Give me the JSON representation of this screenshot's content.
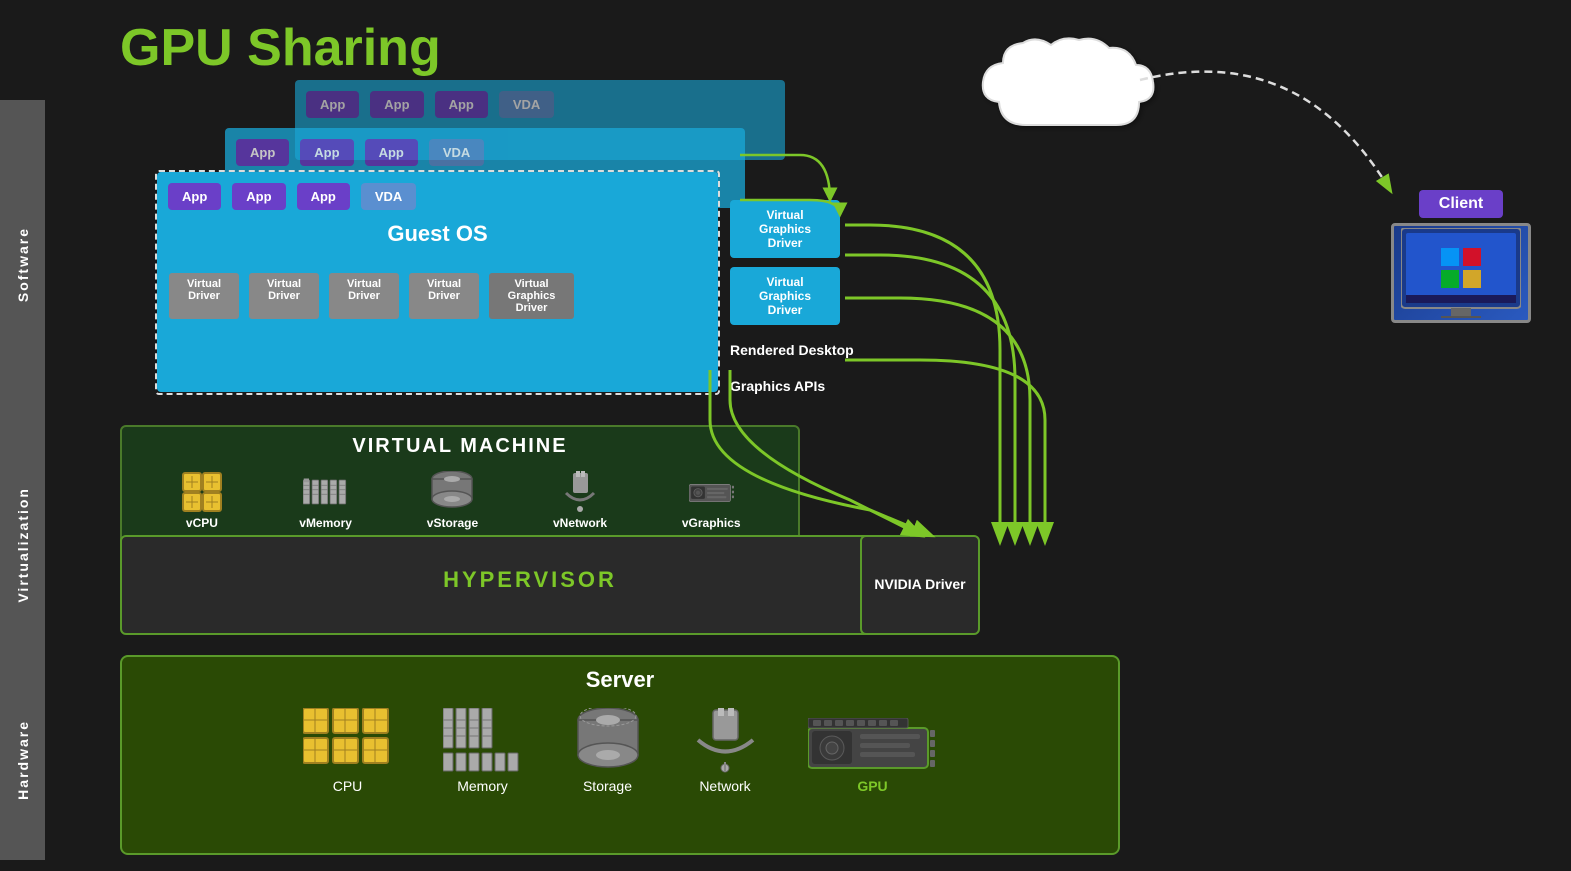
{
  "title": "GPU Sharing",
  "side_labels": {
    "software": "Software",
    "virtualization": "Virtualization",
    "hardware": "Hardware"
  },
  "vm_layers": [
    {
      "id": "vm3",
      "apps": [
        "App",
        "App",
        "App",
        "VDA"
      ],
      "offset": "back"
    },
    {
      "id": "vm2",
      "apps": [
        "App",
        "App",
        "App",
        "VDA"
      ],
      "offset": "middle"
    },
    {
      "id": "vm1",
      "apps": [
        "App",
        "App",
        "App",
        "VDA"
      ],
      "guest_os_label": "Guest OS",
      "drivers": [
        "Virtual\nDriver",
        "Virtual\nDriver",
        "Virtual\nDriver",
        "Virtual\nDriver",
        "Virtual\nGraphics\nDriver"
      ]
    }
  ],
  "right_panel": {
    "vgd_label1": "Virtual\nGraphics\nDriver",
    "vgd_label2": "Virtual\nGraphics\nDriver",
    "rendered_desktop": "Rendered Desktop",
    "graphics_apis": "Graphics APIs"
  },
  "virtual_machine": {
    "title": "VIRTUAL MACHINE",
    "items": [
      {
        "label": "vCPU",
        "icon": "cpu-icon"
      },
      {
        "label": "vMemory",
        "icon": "memory-icon"
      },
      {
        "label": "vStorage",
        "icon": "storage-icon"
      },
      {
        "label": "vNetwork",
        "icon": "network-icon"
      },
      {
        "label": "vGraphics",
        "icon": "graphics-icon"
      }
    ]
  },
  "hypervisor": {
    "label": "HYPERVISOR"
  },
  "nvidia_driver": {
    "label": "NVIDIA\nDriver"
  },
  "server": {
    "title": "Server",
    "items": [
      {
        "label": "CPU",
        "icon": "cpu-hw-icon"
      },
      {
        "label": "Memory",
        "icon": "memory-hw-icon"
      },
      {
        "label": "Storage",
        "icon": "storage-hw-icon"
      },
      {
        "label": "Network",
        "icon": "network-hw-icon"
      },
      {
        "label": "GPU",
        "icon": "gpu-hw-icon"
      }
    ]
  },
  "client": {
    "label": "Client"
  },
  "cloud": {
    "visible": true
  }
}
